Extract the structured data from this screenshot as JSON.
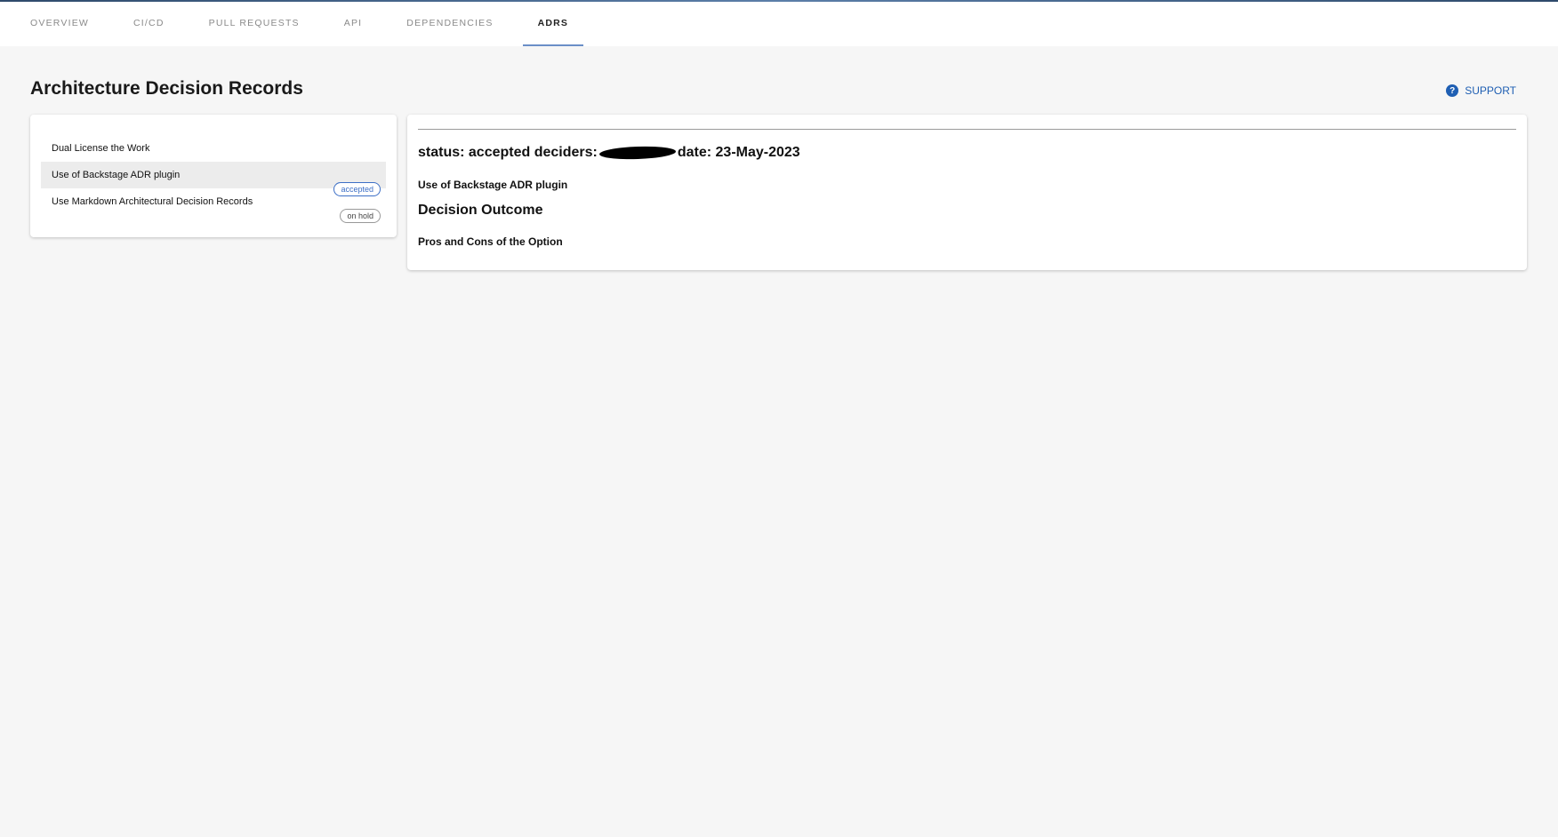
{
  "tabs": [
    {
      "label": "OVERVIEW"
    },
    {
      "label": "CI/CD"
    },
    {
      "label": "PULL REQUESTS"
    },
    {
      "label": "API"
    },
    {
      "label": "DEPENDENCIES"
    },
    {
      "label": "ADRS"
    }
  ],
  "active_tab": "ADRS",
  "page": {
    "title": "Architecture Decision Records",
    "support_label": "SUPPORT",
    "support_icon": "question-circle-icon"
  },
  "adr_list": {
    "items": [
      {
        "title": "Dual License the Work",
        "status": ""
      },
      {
        "title": "Use of Backstage ADR plugin",
        "status": "accepted",
        "selected": true
      },
      {
        "title": "Use Markdown Architectural Decision Records",
        "status": "on hold"
      }
    ]
  },
  "detail": {
    "status_label": "status: accepted deciders:",
    "date_label": "date: 23-May-2023",
    "summary": "Use of Backstage ADR plugin",
    "heading": "Decision Outcome",
    "subheading": "Pros and Cons of the Option"
  },
  "colors": {
    "accent": "#1f5fb3",
    "chip_accepted": "#3d6fc6",
    "tab_indicator": "#6b8fc7",
    "background": "#f6f6f6"
  }
}
